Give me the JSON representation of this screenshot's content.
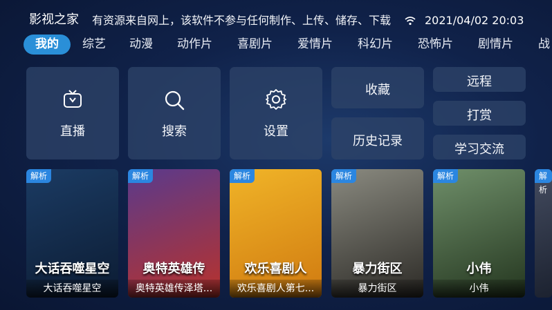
{
  "header": {
    "app_title": "影视之家",
    "marquee": "有资源来自网上，该软件不参与任何制作、上传、储存、下载",
    "clock": "2021/04/02 20:03"
  },
  "tabs": [
    "我的",
    "综艺",
    "动漫",
    "动作片",
    "喜剧片",
    "爱情片",
    "科幻片",
    "恐怖片",
    "剧情片",
    "战"
  ],
  "tiles": {
    "live": "直播",
    "search": "搜索",
    "settings": "设置",
    "favorites": "收藏",
    "history": "历史记录",
    "remote": "远程",
    "donate": "打赏",
    "study": "学习交流"
  },
  "cards": [
    {
      "badge": "解析",
      "title": "大话吞噬星空",
      "poster_text": "大话吞噬星空",
      "colors": [
        "#1b3b63",
        "#0c1c33"
      ]
    },
    {
      "badge": "解析",
      "title": "奥特英雄传泽塔...",
      "poster_text": "奥特英雄传",
      "colors": [
        "#5a3a8c",
        "#b8322c"
      ]
    },
    {
      "badge": "解析",
      "title": "欢乐喜剧人第七...",
      "poster_text": "欢乐喜剧人",
      "colors": [
        "#f0b428",
        "#d07a10"
      ]
    },
    {
      "badge": "解析",
      "title": "暴力街区",
      "poster_text": "暴力街区",
      "colors": [
        "#8a8a80",
        "#2c2a26"
      ]
    },
    {
      "badge": "解析",
      "title": "小伟",
      "poster_text": "小伟",
      "colors": [
        "#6f8f6a",
        "#24361f"
      ]
    },
    {
      "badge": "解析",
      "title": "",
      "poster_text": "",
      "colors": [
        "#444c60",
        "#1c2230"
      ]
    }
  ]
}
